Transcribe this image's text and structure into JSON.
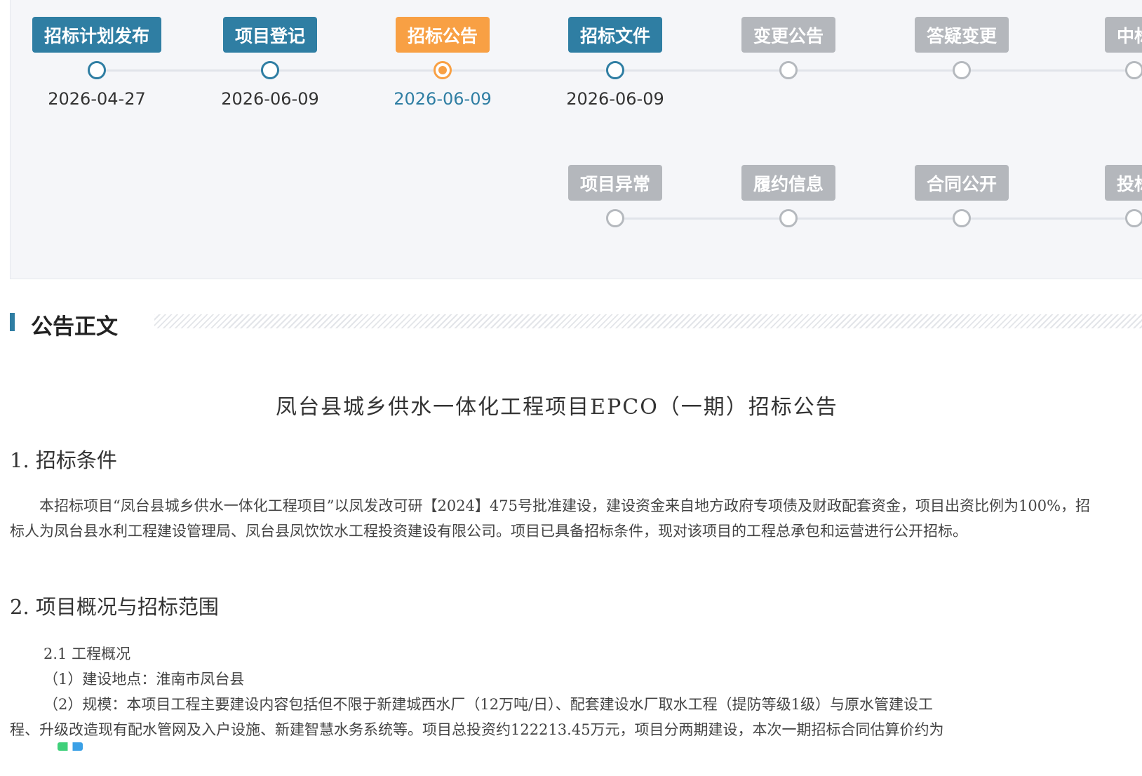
{
  "timeline": {
    "row1": [
      {
        "label": "招标计划发布",
        "date": "2026-04-27",
        "state": "done"
      },
      {
        "label": "项目登记",
        "date": "2026-06-09",
        "state": "done"
      },
      {
        "label": "招标公告",
        "date": "2026-06-09",
        "state": "current"
      },
      {
        "label": "招标文件",
        "date": "2026-06-09",
        "state": "done"
      },
      {
        "label": "变更公告",
        "date": "",
        "state": "pending"
      },
      {
        "label": "答疑变更",
        "date": "",
        "state": "pending"
      },
      {
        "label": "中标",
        "date": "",
        "state": "pending"
      }
    ],
    "row2": [
      {
        "label": "项目异常",
        "state": "pending"
      },
      {
        "label": "履约信息",
        "state": "pending"
      },
      {
        "label": "合同公开",
        "state": "pending"
      },
      {
        "label": "投标",
        "state": "pending"
      }
    ]
  },
  "section": {
    "title": "公告正文"
  },
  "document": {
    "title": "凤台县城乡供水一体化工程项目EPCO（一期）招标公告",
    "h1": "1. 招标条件",
    "p1": "本招标项目“凤台县城乡供水一体化工程项目”以凤发改可研【2024】475号批准建设，建设资金来自地方政府专项债及财政配套资金，项目出资比例为100%，招标人为凤台县水利工程建设管理局、凤台县凤饮饮水工程投资建设有限公司。项目已具备招标条件，现对该项目的工程总承包和运营进行公开招标。",
    "h2": "2. 项目概况与招标范围",
    "sub21": "2.1  工程概况",
    "item1": "（1）建设地点：淮南市凤台县",
    "item2_l1": "（2）规模：本项目工程主要建设内容包括但不限于新建城西水厂（12万吨/日）、配套建设水厂取水工程（提防等级1级）与原水管建设工",
    "item2_l2": "程、升级改造现有配水管网及入户设施、新建智慧水务系统等。项目总投资约122213.45万元，项目分两期建设，本次一期招标合同估算价约为"
  }
}
